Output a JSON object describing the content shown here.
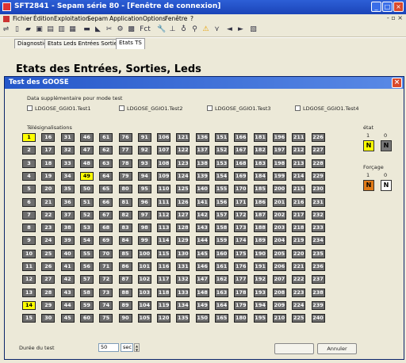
{
  "window": {
    "title": "SFT2841 - Sepam série 80 - [Fenêtre de connexion]"
  },
  "menu": [
    "Fichier",
    "Édition",
    "Exploitation",
    "Sepam",
    "Application",
    "Options",
    "Fenêtre",
    "?"
  ],
  "tabs": [
    "Diagnostic",
    "Etats Leds Entrées Sorties",
    "Etats TS"
  ],
  "page_title": "Etats des Entrées, Sorties, Leds",
  "dialog": {
    "title": "Test des GOOSE",
    "section_label": "Data supplémentaire pour mode test",
    "checkboxes": [
      "LDGOSE_GGIO1.Test1",
      "LDGOSE_GGIO1.Test2",
      "LDGOSE_GGIO1.Test3",
      "LDGOSE_GGIO1.Test4"
    ],
    "grid_label": "Télésignalisations",
    "grid_active": [
      1,
      14,
      49
    ],
    "etat": {
      "label": "état",
      "one": "1",
      "zero": "0",
      "box1": "N",
      "box0": "N"
    },
    "forcage": {
      "label": "Forçage",
      "one": "1",
      "zero": "0",
      "box1": "N",
      "box0": "N"
    },
    "duration": {
      "label": "Durée du test",
      "value": "50",
      "unit": "sec"
    },
    "buttons": {
      "ok": "",
      "cancel": "Annuler"
    }
  }
}
